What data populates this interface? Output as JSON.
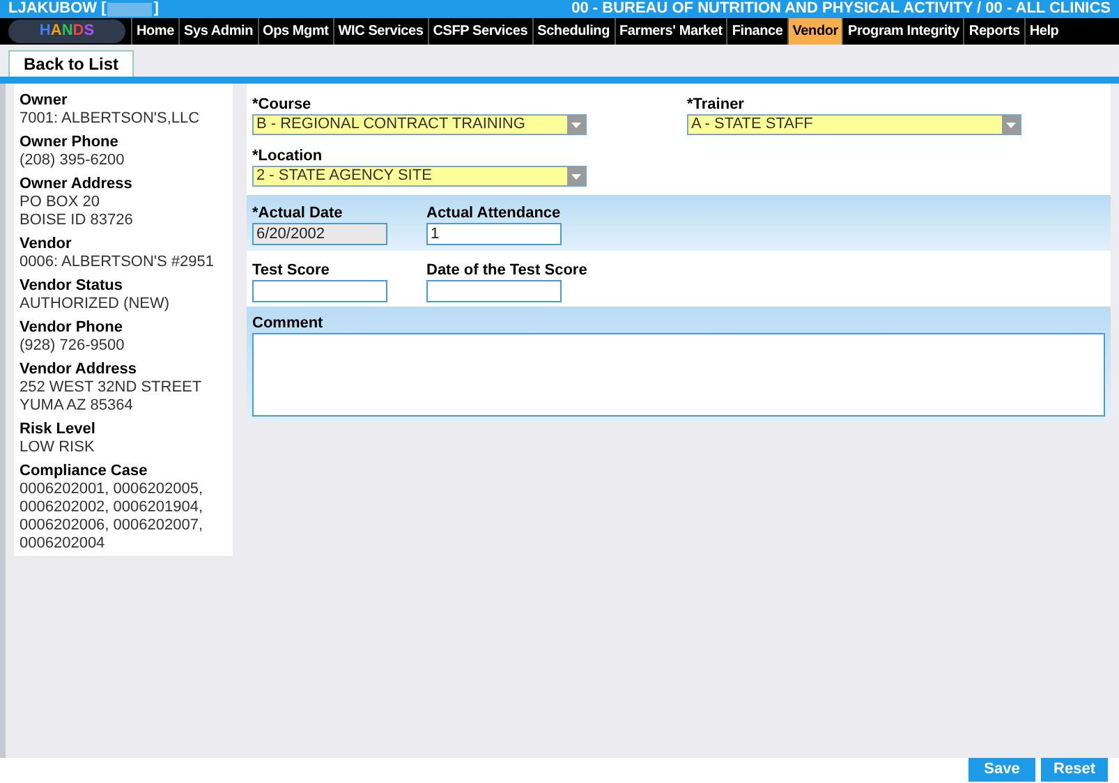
{
  "header": {
    "user_label": "LJAKUBOW [",
    "user_close": "]",
    "agency": "00 - BUREAU OF NUTRITION AND PHYSICAL ACTIVITY / 00 - ALL CLINICS"
  },
  "logo": {
    "text": "HANDS"
  },
  "nav": [
    {
      "label": "Home",
      "selected": false
    },
    {
      "label": "Sys Admin",
      "selected": false
    },
    {
      "label": "Ops Mgmt",
      "selected": false
    },
    {
      "label": "WIC Services",
      "selected": false
    },
    {
      "label": "CSFP Services",
      "selected": false
    },
    {
      "label": "Scheduling",
      "selected": false
    },
    {
      "label": "Farmers' Market",
      "selected": false
    },
    {
      "label": "Finance",
      "selected": false
    },
    {
      "label": "Vendor",
      "selected": true
    },
    {
      "label": "Program Integrity",
      "selected": false
    },
    {
      "label": "Reports",
      "selected": false
    },
    {
      "label": "Help",
      "selected": false
    }
  ],
  "back_button": "Back to List",
  "sidebar": [
    {
      "label": "Owner",
      "lines": [
        "7001: ALBERTSON'S,LLC"
      ]
    },
    {
      "label": "Owner Phone",
      "lines": [
        "(208) 395-6200"
      ]
    },
    {
      "label": "Owner Address",
      "lines": [
        "PO BOX 20",
        "BOISE ID 83726"
      ]
    },
    {
      "label": "Vendor",
      "lines": [
        "0006: ALBERTSON'S #2951"
      ]
    },
    {
      "label": "Vendor Status",
      "lines": [
        "AUTHORIZED (NEW)"
      ]
    },
    {
      "label": "Vendor Phone",
      "lines": [
        "(928) 726-9500"
      ]
    },
    {
      "label": "Vendor Address",
      "lines": [
        "252 WEST 32ND STREET",
        "YUMA AZ 85364"
      ]
    },
    {
      "label": "Risk Level",
      "lines": [
        "LOW RISK"
      ]
    },
    {
      "label": "Compliance Case",
      "lines": [
        "0006202001, 0006202005,",
        "0006202002, 0006201904,",
        "0006202006, 0006202007,",
        "0006202004"
      ]
    }
  ],
  "form": {
    "course": {
      "label": "*Course",
      "value": "B - REGIONAL CONTRACT TRAINING"
    },
    "trainer": {
      "label": "*Trainer",
      "value": "A - STATE STAFF"
    },
    "location": {
      "label": "*Location",
      "value": "2 - STATE AGENCY SITE"
    },
    "actual_date": {
      "label": "*Actual Date",
      "value": "6/20/2002",
      "disabled": true
    },
    "actual_attendance": {
      "label": "Actual Attendance",
      "value": "1",
      "disabled": false
    },
    "test_score": {
      "label": "Test Score",
      "disabled": false
    },
    "test_score_date": {
      "label": "Date of the Test Score",
      "disabled": false
    },
    "comment": {
      "label": "Comment"
    }
  },
  "buttons": [
    "Save",
    "Reset"
  ]
}
